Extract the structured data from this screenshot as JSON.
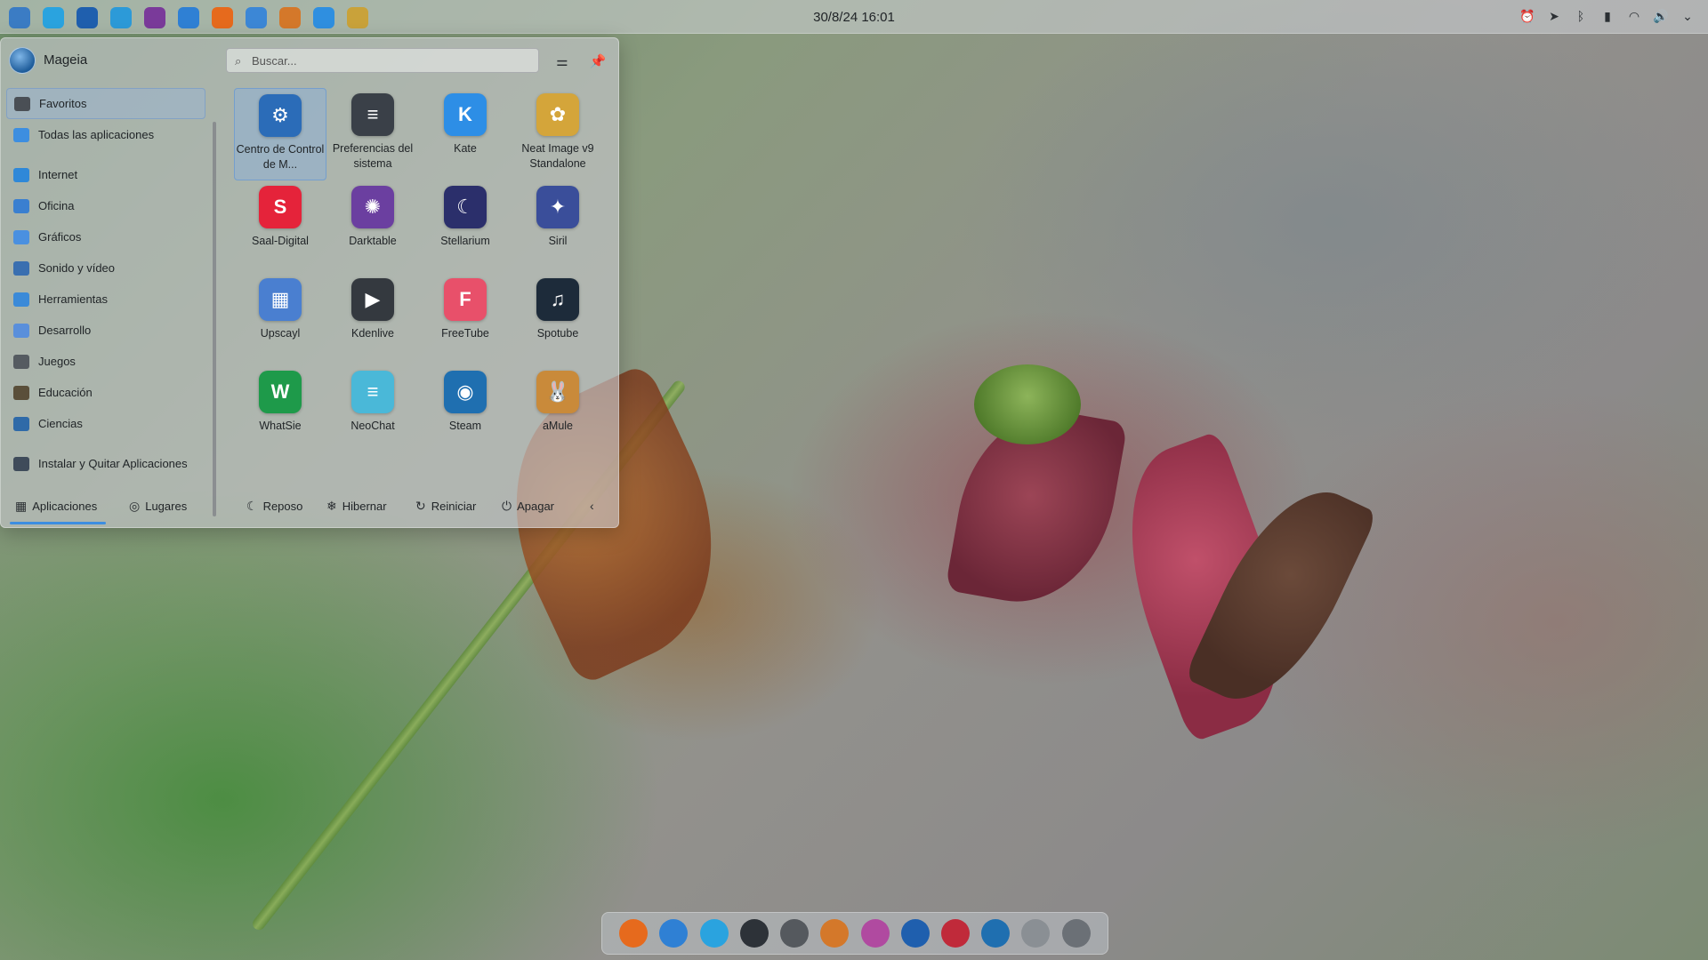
{
  "clock": "30/8/24 16:01",
  "top_apps": [
    {
      "icon": "mageia-icon",
      "color": "#3b7cc4"
    },
    {
      "icon": "telegram-icon",
      "color": "#2aa3df"
    },
    {
      "icon": "thunderbird-icon",
      "color": "#1f5fae"
    },
    {
      "icon": "file-manager-icon",
      "color": "#2c9ad8"
    },
    {
      "icon": "darktable-icon",
      "color": "#7a3a9a"
    },
    {
      "icon": "bird-icon",
      "color": "#2f80d4"
    },
    {
      "icon": "firefox-icon",
      "color": "#e66a1d"
    },
    {
      "icon": "document-icon",
      "color": "#3c87d6"
    },
    {
      "icon": "amule-icon",
      "color": "#d4782a"
    },
    {
      "icon": "kate-icon",
      "color": "#2f8fe0"
    },
    {
      "icon": "neat-image-icon",
      "color": "#c9a23a"
    }
  ],
  "tray": [
    "alarm-icon",
    "telegram-tray-icon",
    "bluetooth-icon",
    "battery-icon",
    "wifi-icon",
    "volume-icon",
    "chevron-down-icon"
  ],
  "launcher": {
    "user": "Mageia",
    "search_placeholder": "Buscar...",
    "categories": [
      {
        "label": "Favoritos",
        "icon": "bookmark-icon",
        "color": "#4a4f55",
        "selected": true
      },
      {
        "label": "Todas las aplicaciones",
        "icon": "grid-icon",
        "color": "#3d8ee0"
      },
      {
        "label": "Internet",
        "icon": "globe-icon",
        "color": "#2f88d8"
      },
      {
        "label": "Oficina",
        "icon": "office-icon",
        "color": "#3a7fd0"
      },
      {
        "label": "Gráficos",
        "icon": "graphics-icon",
        "color": "#4a90e0"
      },
      {
        "label": "Sonido y vídeo",
        "icon": "multimedia-icon",
        "color": "#3a6fb0"
      },
      {
        "label": "Herramientas",
        "icon": "tools-icon",
        "color": "#3b8ad8"
      },
      {
        "label": "Desarrollo",
        "icon": "development-icon",
        "color": "#5a8fdb"
      },
      {
        "label": "Juegos",
        "icon": "gamepad-icon",
        "color": "#555b61"
      },
      {
        "label": "Educación",
        "icon": "education-icon",
        "color": "#5a4f3a"
      },
      {
        "label": "Ciencias",
        "icon": "flask-icon",
        "color": "#2f6aa8"
      },
      {
        "label": "Instalar y Quitar Aplicaciones",
        "icon": "install-icon",
        "color": "#3f4b5a"
      }
    ],
    "apps": [
      {
        "label": "Centro de Control de M...",
        "icon": "control-center-icon",
        "color": "#2b6cb8",
        "glyph": "⚙",
        "selected": true
      },
      {
        "label": "Preferencias del sistema",
        "icon": "system-settings-icon",
        "color": "#3a4048",
        "glyph": "≡"
      },
      {
        "label": "Kate",
        "icon": "kate-icon",
        "color": "#2d8ee6",
        "glyph": "K"
      },
      {
        "label": "Neat Image v9 Standalone",
        "icon": "neat-image-icon",
        "color": "#d4a53a",
        "glyph": "✿"
      },
      {
        "label": "Saal-Digital",
        "icon": "saal-digital-icon",
        "color": "#e5233a",
        "glyph": "S"
      },
      {
        "label": "Darktable",
        "icon": "darktable-icon",
        "color": "#6b3fa0",
        "glyph": "✺"
      },
      {
        "label": "Stellarium",
        "icon": "stellarium-icon",
        "color": "#2b2f6b",
        "glyph": "☾"
      },
      {
        "label": "Siril",
        "icon": "siril-icon",
        "color": "#3a4e9a",
        "glyph": "✦"
      },
      {
        "label": "Upscayl",
        "icon": "upscayl-icon",
        "color": "#4a7fd0",
        "glyph": "▦"
      },
      {
        "label": "Kdenlive",
        "icon": "kdenlive-icon",
        "color": "#34393f",
        "glyph": "▶"
      },
      {
        "label": "FreeTube",
        "icon": "freetube-icon",
        "color": "#e8506a",
        "glyph": "F"
      },
      {
        "label": "Spotube",
        "icon": "spotube-icon",
        "color": "#1d2b3a",
        "glyph": "♫"
      },
      {
        "label": "WhatSie",
        "icon": "whatsie-icon",
        "color": "#1e9a4a",
        "glyph": "W"
      },
      {
        "label": "NeoChat",
        "icon": "neochat-icon",
        "color": "#4ab8d8",
        "glyph": "≡"
      },
      {
        "label": "Steam",
        "icon": "steam-icon",
        "color": "#1f6fb0",
        "glyph": "◉"
      },
      {
        "label": "aMule",
        "icon": "amule-icon",
        "color": "#c98a3a",
        "glyph": "🐰"
      }
    ],
    "footer": {
      "applications": "Aplicaciones",
      "places": "Lugares",
      "sleep": "Reposo",
      "hibernate": "Hibernar",
      "restart": "Reiniciar",
      "shutdown": "Apagar"
    }
  },
  "dock": [
    {
      "icon": "firefox-icon",
      "color": "#e66a1d"
    },
    {
      "icon": "bird-icon",
      "color": "#2f80d4"
    },
    {
      "icon": "telegram-icon",
      "color": "#2aa3df"
    },
    {
      "icon": "terminal-icon",
      "color": "#2d3238"
    },
    {
      "icon": "aperture-icon",
      "color": "#55595e"
    },
    {
      "icon": "amule-icon",
      "color": "#d4782a"
    },
    {
      "icon": "color-picker-icon",
      "color": "#b04aa0"
    },
    {
      "icon": "thunderbird-icon",
      "color": "#1f5fae"
    },
    {
      "icon": "record-icon",
      "color": "#c02a3a"
    },
    {
      "icon": "steam-icon",
      "color": "#1f6fb0"
    },
    {
      "icon": "trash-icon",
      "color": "#8a8f94"
    },
    {
      "icon": "power-icon",
      "color": "#6b7076"
    }
  ]
}
